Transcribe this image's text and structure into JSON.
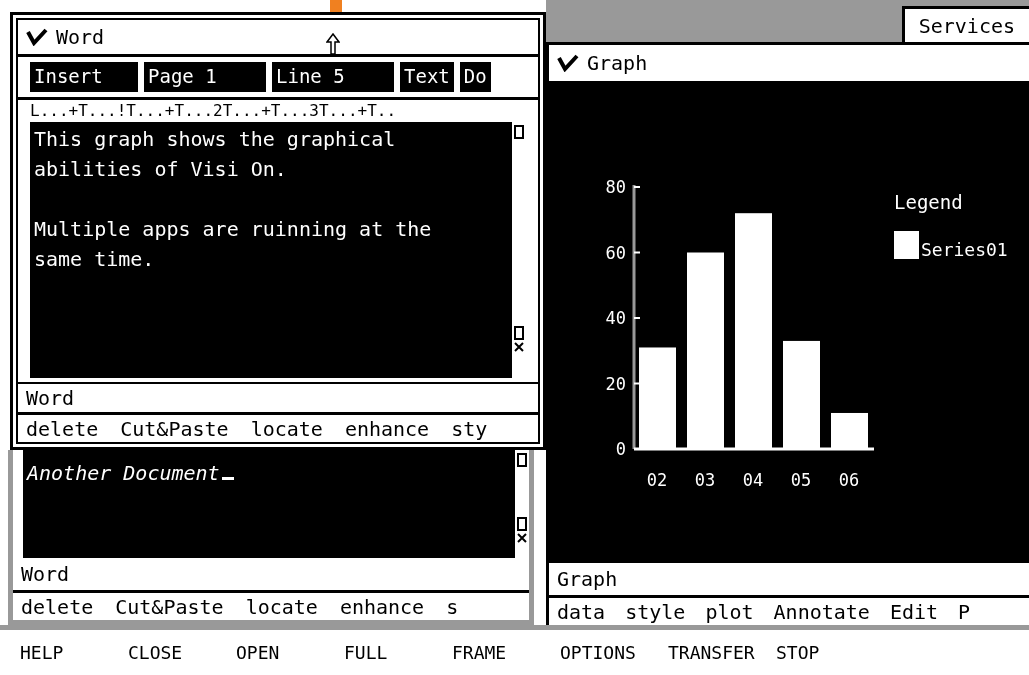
{
  "word_window": {
    "title": "Word",
    "status_fields": [
      {
        "label": "Insert"
      },
      {
        "label": "Page 1"
      },
      {
        "label": "Line 5"
      },
      {
        "label": "Text"
      },
      {
        "label": "Do"
      }
    ],
    "ruler": "L...+T...!T...+T...2T...+T...3T...+T..",
    "paragraphs": [
      [
        "This graph shows the graphical",
        "abilities of Visi On."
      ],
      [
        "Multiple apps are ruinning at the",
        "same time."
      ]
    ],
    "status_label": "Word",
    "menu": [
      "delete",
      "Cut&Paste",
      "locate",
      "enhance",
      "sty"
    ]
  },
  "back_window": {
    "document_text": "Another Document",
    "status_label": "Word",
    "menu": [
      "delete",
      "Cut&Paste",
      "locate",
      "enhance",
      "s"
    ]
  },
  "services": "Services",
  "graph_window": {
    "title": "Graph",
    "legend_title": "Legend",
    "chart_data": {
      "type": "bar",
      "categories": [
        "02",
        "03",
        "04",
        "05",
        "06"
      ],
      "series": [
        {
          "name": "Series01",
          "color": "#ffffff",
          "values": [
            31,
            60,
            72,
            33,
            11
          ]
        }
      ],
      "ylim": [
        0,
        80
      ],
      "yticks": [
        0,
        20,
        40,
        60,
        80
      ]
    },
    "status_label": "Graph",
    "menu": [
      "data",
      "style",
      "plot",
      "Annotate",
      "Edit",
      "P"
    ]
  },
  "command_bar": [
    "HELP",
    "CLOSE",
    "OPEN",
    "FULL",
    "FRAME",
    "OPTIONS",
    "TRANSFER",
    "STOP"
  ]
}
